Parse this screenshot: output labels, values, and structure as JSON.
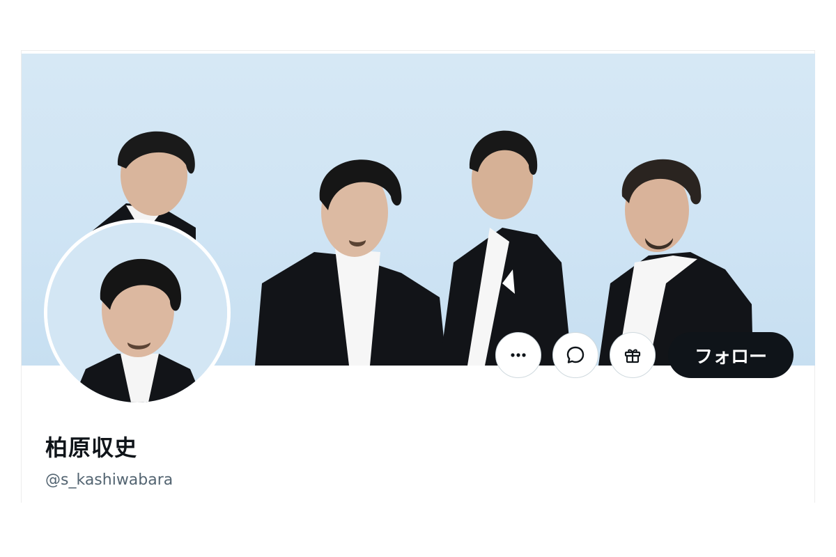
{
  "profile": {
    "display_name": "柏原収史",
    "handle": "@s_kashiwabara"
  },
  "banner": {
    "description_icon": "group-photo"
  },
  "actions": {
    "more_icon": "more-icon",
    "message_icon": "message-icon",
    "gift_icon": "gift-icon",
    "follow_label": "フォロー"
  },
  "colors": {
    "follow_bg": "#0f1419",
    "follow_text": "#ffffff",
    "handle_text": "#536471",
    "border": "#cfd9de",
    "banner_bg": "#d6e8f5"
  }
}
